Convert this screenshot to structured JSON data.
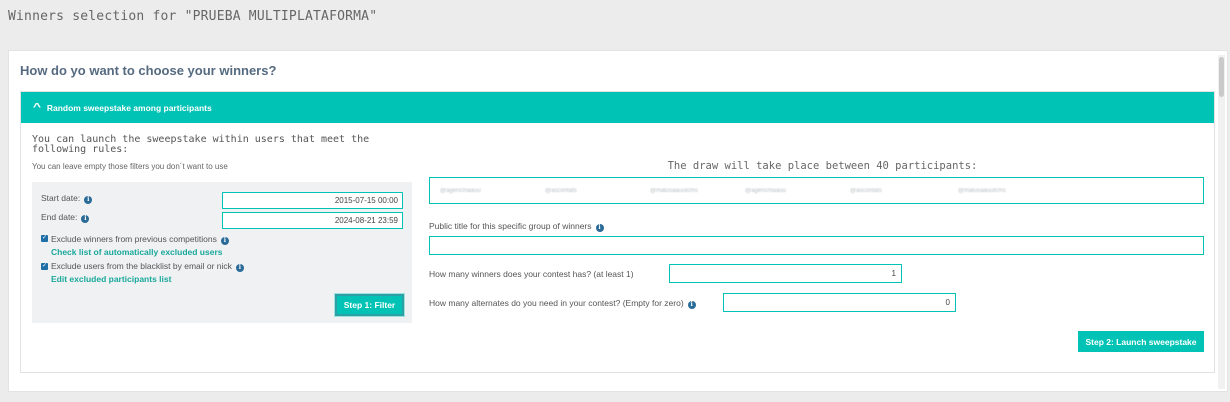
{
  "page": {
    "title": "Winners selection for \"PRUEBA MULTIPLATAFORMA\""
  },
  "card": {
    "heading": "How do yo want to choose your winners?"
  },
  "panel": {
    "header_label": "Random sweepstake among participants",
    "rules_title": "You can launch the sweepstake within users that meet the following rules:",
    "rules_subtitle": "You can leave empty those filters you don´t want to use",
    "filters": {
      "start_label": "Start date:",
      "start_value": "2015-07-15 00:00",
      "end_label": "End date:",
      "end_value": "2024-08-21 23:59",
      "exclude_winners_label": "Exclude winners from previous competitions",
      "exclude_winners_checked": true,
      "check_list_link": "Check list of automatically excluded users",
      "exclude_blacklist_label": "Exclude users from the blacklist by email or nick",
      "exclude_blacklist_checked": true,
      "edit_list_link": "Edit excluded participants list",
      "filter_button": "Step 1: Filter"
    },
    "draw": {
      "title": "The draw will take place between 40 participants:",
      "participants": [
        "@agencmaauu",
        "@ascontats",
        "@malusaauulcms",
        "@agencmaauu",
        "@ascontats",
        "@malusaauulcms"
      ]
    },
    "public_title_label": "Public title for this specific group of winners",
    "public_title_value": "",
    "winners_label": "How many winners does your contest has? (at least 1)",
    "winners_value": "1",
    "alternates_label": "How many alternates do you need in your contest? (Empty for zero)",
    "alternates_value": "0",
    "launch_button": "Step 2: Launch sweepstake"
  },
  "colors": {
    "accent": "#00c3b5",
    "info_icon": "#2a6b98",
    "link": "#1aa89b"
  }
}
